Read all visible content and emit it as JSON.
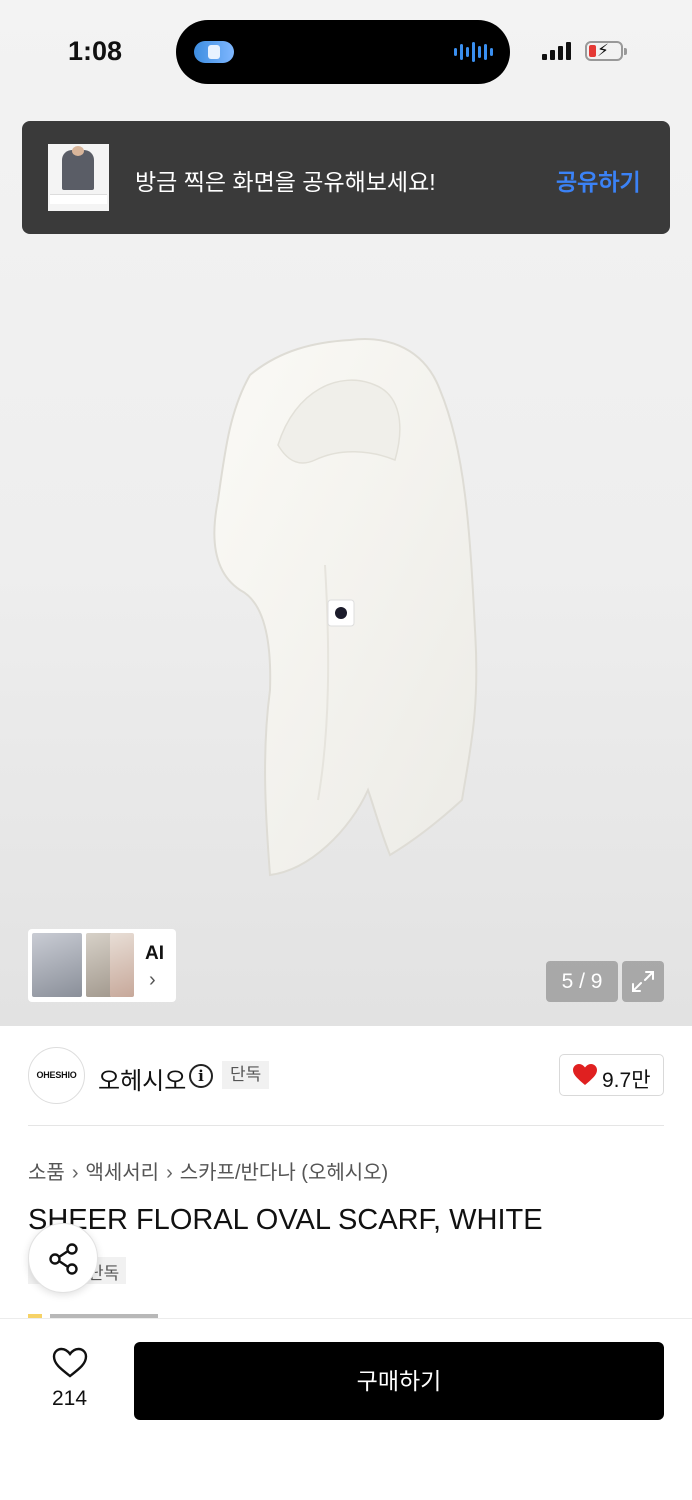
{
  "status_bar": {
    "time": "1:08"
  },
  "share_banner": {
    "message": "방금 찍은 화면을 공유해보세요!",
    "action_label": "공유하기"
  },
  "gallery": {
    "ai_label": "AI",
    "ai_chevron": "›",
    "counter": "5 / 9"
  },
  "brand": {
    "logo_text": "OHESHIO",
    "name": "오헤시오",
    "info_icon": "i",
    "badge": "단독"
  },
  "likes": {
    "count": "9.7만",
    "heart_color": "#e02020"
  },
  "product": {
    "breadcrumb": [
      "소품",
      "액세서리",
      "스카프/반다나 (오헤시오)"
    ],
    "breadcrumb_separator": "›",
    "title": "SHEER FLORAL OVAL SCARF, WHITE",
    "badge": "단독"
  },
  "bottom_bar": {
    "wish_count": "214",
    "buy_label": "구매하기"
  },
  "icons": [
    "share-icon",
    "heart-icon",
    "info-icon",
    "expand-icon",
    "chevron-right-icon",
    "signal-icon",
    "battery-icon"
  ],
  "colors": {
    "accent_blue": "#3b82f6",
    "banner_bg": "#3a3a3a",
    "buy_bg": "#000000"
  }
}
